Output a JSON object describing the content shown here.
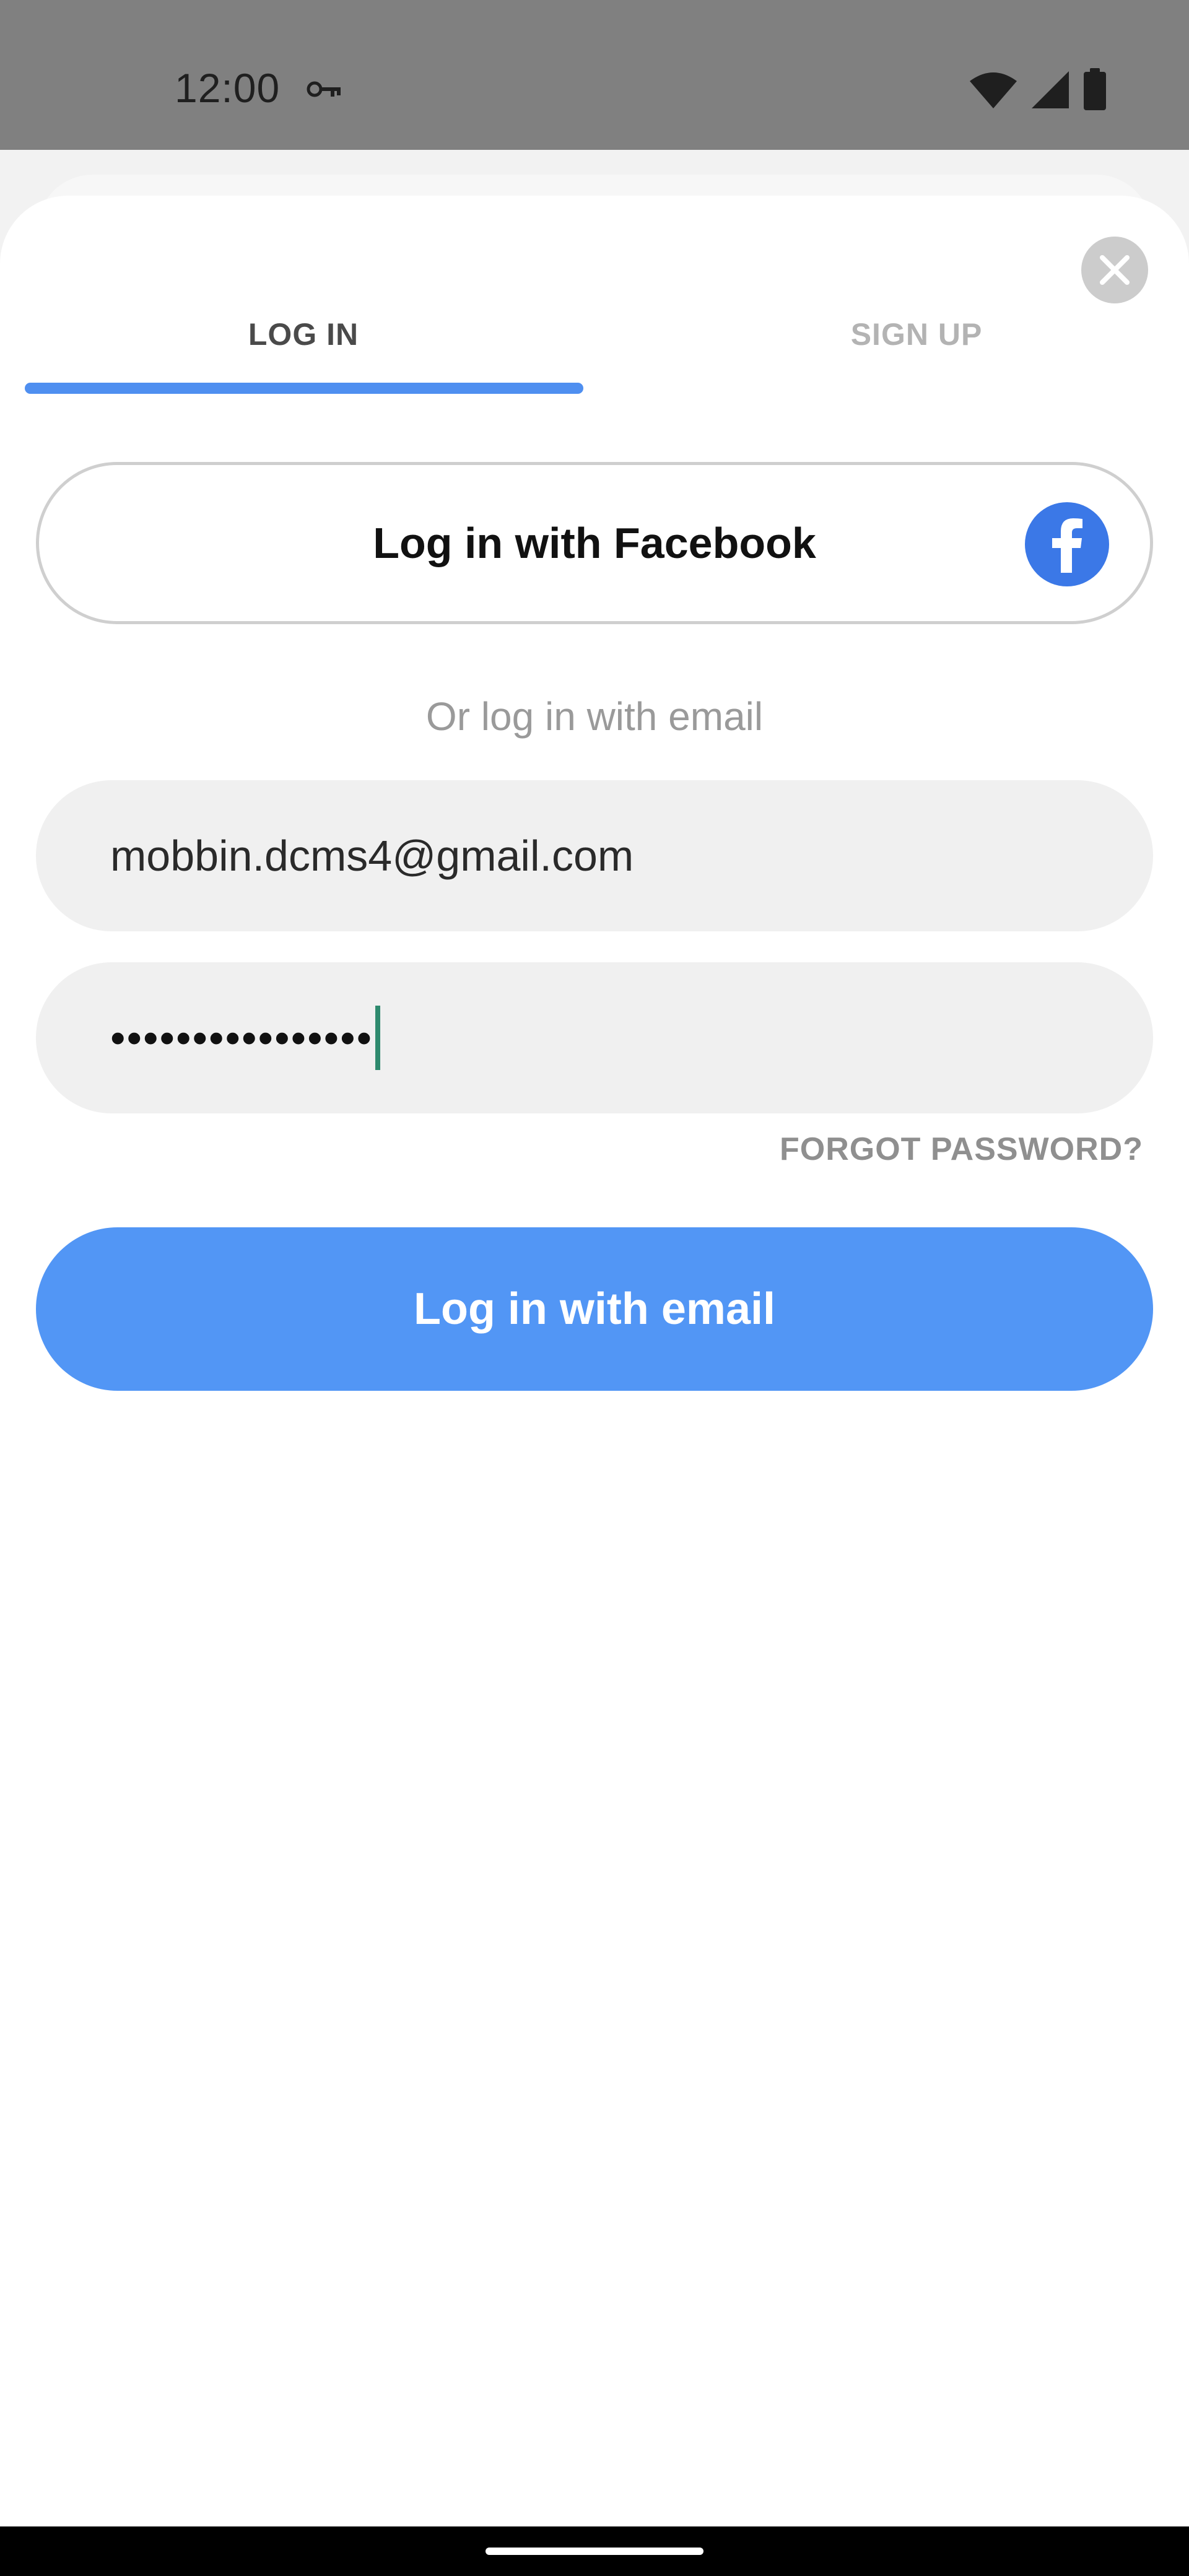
{
  "status_bar": {
    "time": "12:00"
  },
  "tabs": {
    "login_label": "LOG IN",
    "signup_label": "SIGN UP",
    "active": "LOG IN"
  },
  "facebook_button": {
    "label": "Log in with Facebook",
    "icon_letter": "f"
  },
  "divider_text": "Or log in with email",
  "email_field": {
    "value": "mobbin.dcms4@gmail.com"
  },
  "password_field": {
    "masked_value": "••••••••••••••••"
  },
  "forgot_password_label": "FORGOT PASSWORD?",
  "email_login_button": {
    "label": "Log in with email"
  },
  "colors": {
    "accent": "#4f8ff0",
    "primary_button": "#5296f5",
    "facebook": "#3b78e7",
    "status_bar": "#808080",
    "field_background": "#f0f0f0",
    "cursor": "#2e8a6e"
  },
  "icons": {
    "status_key": "key-icon",
    "wifi": "wifi-icon",
    "signal": "signal-icon",
    "battery": "battery-icon",
    "close": "close-icon",
    "facebook": "facebook-icon"
  }
}
